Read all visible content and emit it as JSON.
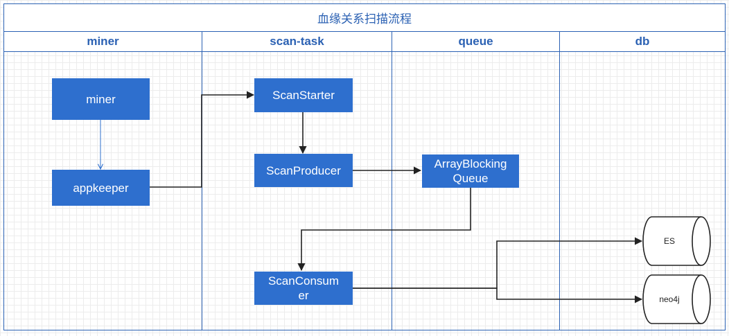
{
  "title": "血缘关系扫描流程",
  "lanes": [
    "miner",
    "scan-task",
    "queue",
    "db"
  ],
  "nodes": {
    "miner": "miner",
    "appkeeper": "appkeeper",
    "scan_starter": "ScanStarter",
    "scan_producer": "ScanProducer",
    "array_blocking_queue_line1": "ArrayBlocking",
    "array_blocking_queue_line2": "Queue",
    "scan_consumer_line1": "ScanConsum",
    "scan_consumer_line2": "er"
  },
  "databases": {
    "es": "ES",
    "neo4j": "neo4j"
  },
  "colors": {
    "lane_border": "#2b61b3",
    "node_fill": "#2e6fce",
    "node_text": "#ffffff",
    "edge": "#222222"
  }
}
